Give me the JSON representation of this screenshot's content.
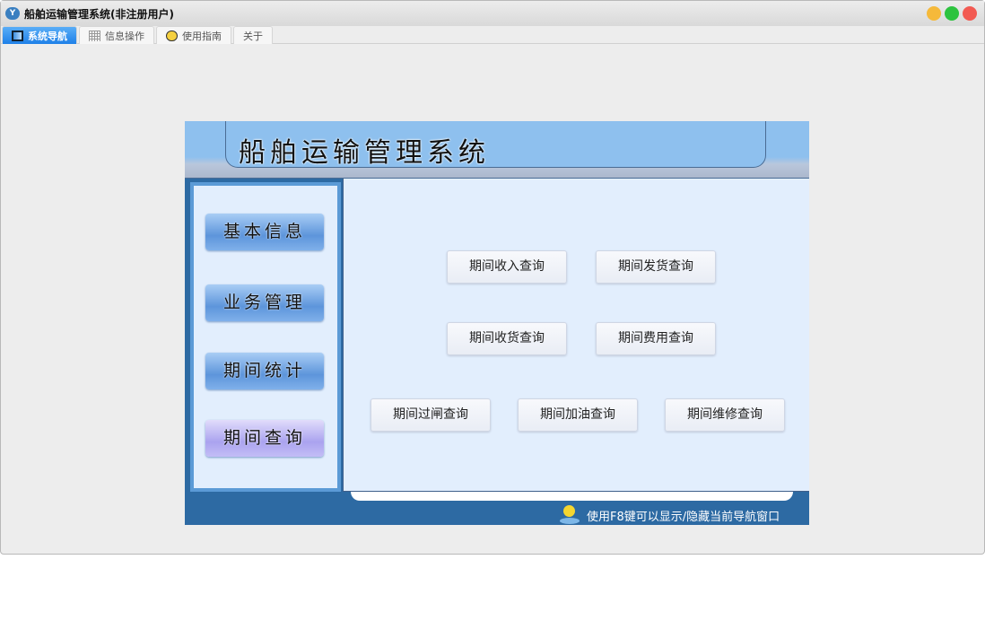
{
  "window": {
    "title": "船舶运输管理系统(非注册用户)",
    "colors": {
      "minimize": "#f5b93a",
      "maximize": "#2dc33f",
      "close": "#f25a52"
    }
  },
  "tabs": [
    {
      "label": "系统导航",
      "icon": "monitor-icon"
    },
    {
      "label": "信息操作",
      "icon": "grid-icon"
    },
    {
      "label": "使用指南",
      "icon": "help-icon"
    },
    {
      "label": "关于"
    }
  ],
  "header": {
    "title": "船舶运输管理系统"
  },
  "nav": [
    "基本信息",
    "业务管理",
    "期间统计",
    "期间查询"
  ],
  "queries": [
    "期间收入查询",
    "期间发货查询",
    "期间收货查询",
    "期间费用查询",
    "期间过闸查询",
    "期间加油查询",
    "期间维修查询"
  ],
  "hint": "使用F8键可以显示/隐藏当前导航窗口"
}
